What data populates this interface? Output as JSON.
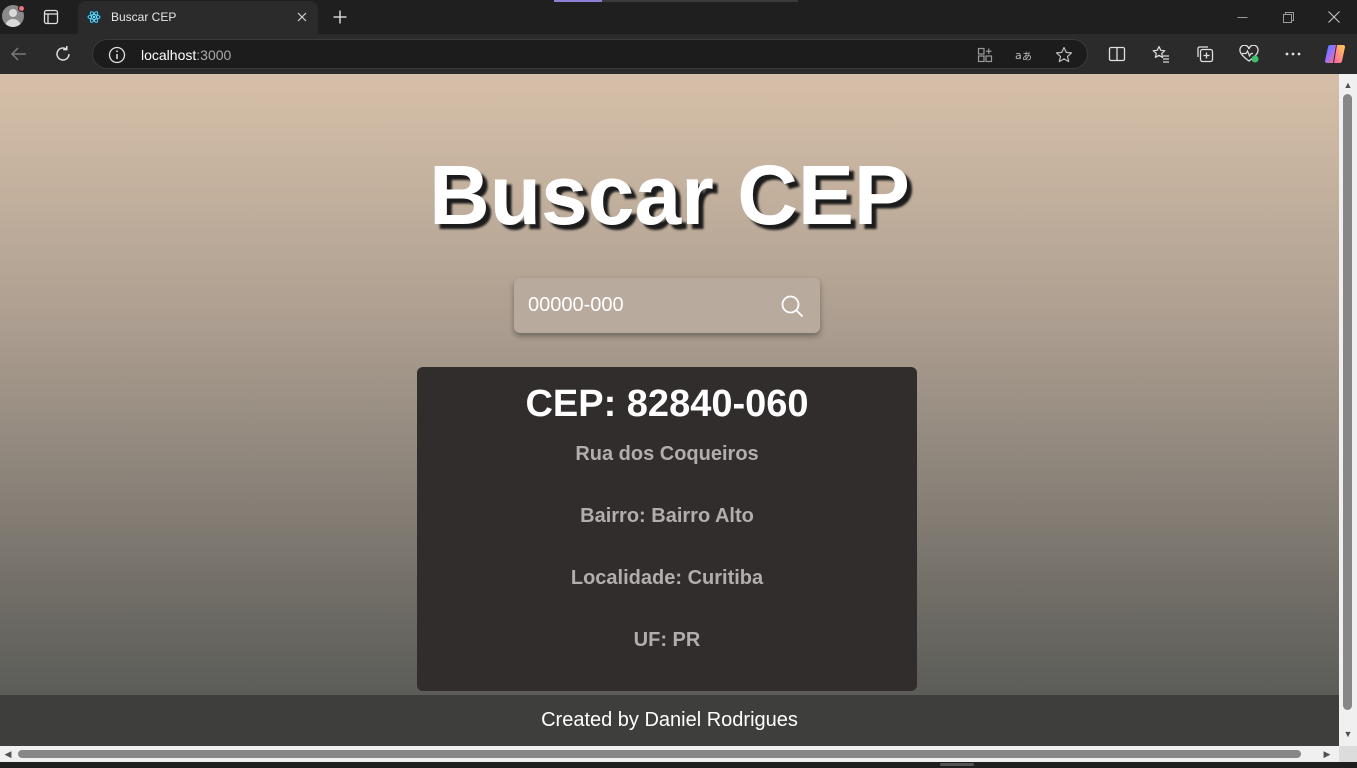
{
  "browser": {
    "tab_title": "Buscar CEP",
    "url_host": "localhost",
    "url_port": ":3000"
  },
  "page": {
    "title": "Buscar CEP",
    "search": {
      "placeholder": "00000-000",
      "value": ""
    },
    "result": {
      "cep": "CEP: 82840-060",
      "logradouro": "Rua dos Coqueiros",
      "bairro": "Bairro: Bairro Alto",
      "localidade": "Localidade: Curitiba",
      "uf": "UF: PR"
    },
    "footer": "Created by Daniel Rodrigues"
  },
  "icons": {
    "tab_favicon": "react-logo-icon",
    "search": "search-icon"
  },
  "colors": {
    "card_background": "#312d2c",
    "footer_background": "#3e3f3d",
    "search_box": "#b8aa9d"
  }
}
